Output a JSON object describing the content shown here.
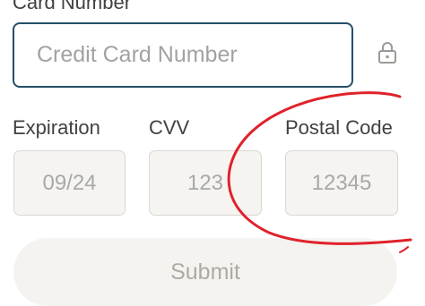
{
  "card": {
    "label": "Card Number",
    "placeholder": "Credit Card Number",
    "value": ""
  },
  "expiration": {
    "label": "Expiration",
    "placeholder": "09/24",
    "value": ""
  },
  "cvv": {
    "label": "CVV",
    "placeholder": "123",
    "value": ""
  },
  "postal": {
    "label": "Postal Code",
    "placeholder": "12345",
    "value": ""
  },
  "submit": {
    "label": "Submit"
  },
  "icons": {
    "lock": "lock-icon"
  },
  "colors": {
    "focus_border": "#254f68",
    "annotation": "#e0212b",
    "field_background": "#f5f4f1"
  }
}
